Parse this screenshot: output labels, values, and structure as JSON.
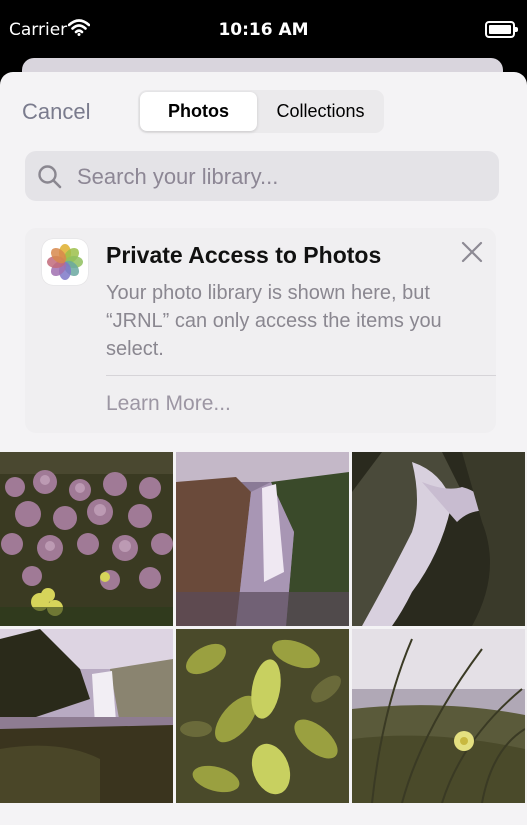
{
  "status_bar": {
    "carrier": "Carrier",
    "time": "10:16 AM"
  },
  "header": {
    "cancel_label": "Cancel",
    "tabs": [
      {
        "label": "Photos",
        "selected": true
      },
      {
        "label": "Collections",
        "selected": false
      }
    ]
  },
  "search": {
    "placeholder": "Search your library..."
  },
  "banner": {
    "title": "Private Access to Photos",
    "body": "Your photo library is shown here, but “JRNL” can only access the items you select.",
    "learn_more": "Learn More..."
  },
  "photos": [
    {
      "subject": "pink flower field"
    },
    {
      "subject": "waterfall from cliff"
    },
    {
      "subject": "waterfall cascade"
    },
    {
      "subject": "waterfall at shore"
    },
    {
      "subject": "green leaves"
    },
    {
      "subject": "grass with flower"
    }
  ],
  "colors": {
    "accent_gray": "#7a7b8d",
    "sheet_bg": "#f4f3f5"
  }
}
